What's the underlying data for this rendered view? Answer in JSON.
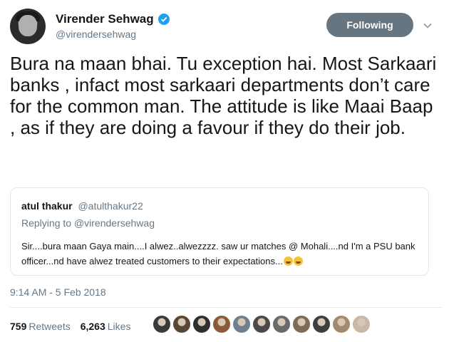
{
  "author": {
    "display_name": "Virender Sehwag",
    "handle": "@virendersehwag",
    "verified": true
  },
  "follow_button": {
    "label": "Following"
  },
  "tweet": {
    "text": "Bura na maan bhai. Tu exception hai. Most Sarkaari banks , infact most sarkaari departments don’t care for the common man. The attitude is like Maai Baap , as if they are doing a favour if they do their job."
  },
  "quoted_tweet": {
    "name": "atul thakur",
    "handle": "@atulthakur22",
    "replying_to_label": "Replying to",
    "replying_to_handle": "@virendersehwag",
    "text": "Sir....bura maan Gaya main....I alwez..alwezzzz. saw ur matches @ Mohali....nd I'm a PSU bank officer...nd have alwez treated customers to their expectations..."
  },
  "timestamp": "9:14 AM - 5 Feb 2018",
  "stats": {
    "retweets_count": "759",
    "retweets_label": "Retweets",
    "likes_count": "6,263",
    "likes_label": "Likes"
  },
  "colors": {
    "verified": "#1da1f2",
    "follow_button": "#66757f",
    "secondary_text": "#657786",
    "border": "#e1e8ed"
  },
  "icons": [
    "verified-badge-icon",
    "chevron-down-icon",
    "laughing-emoji-icon"
  ],
  "liker_avatar_colors": [
    "#3a3a3a",
    "#5a4634",
    "#2f2f2f",
    "#8a5a3a",
    "#6f7f8f",
    "#4a4a4a",
    "#6a6a6a",
    "#7d6b55",
    "#3f3f3f",
    "#a08a70",
    "#c8b8a8"
  ]
}
